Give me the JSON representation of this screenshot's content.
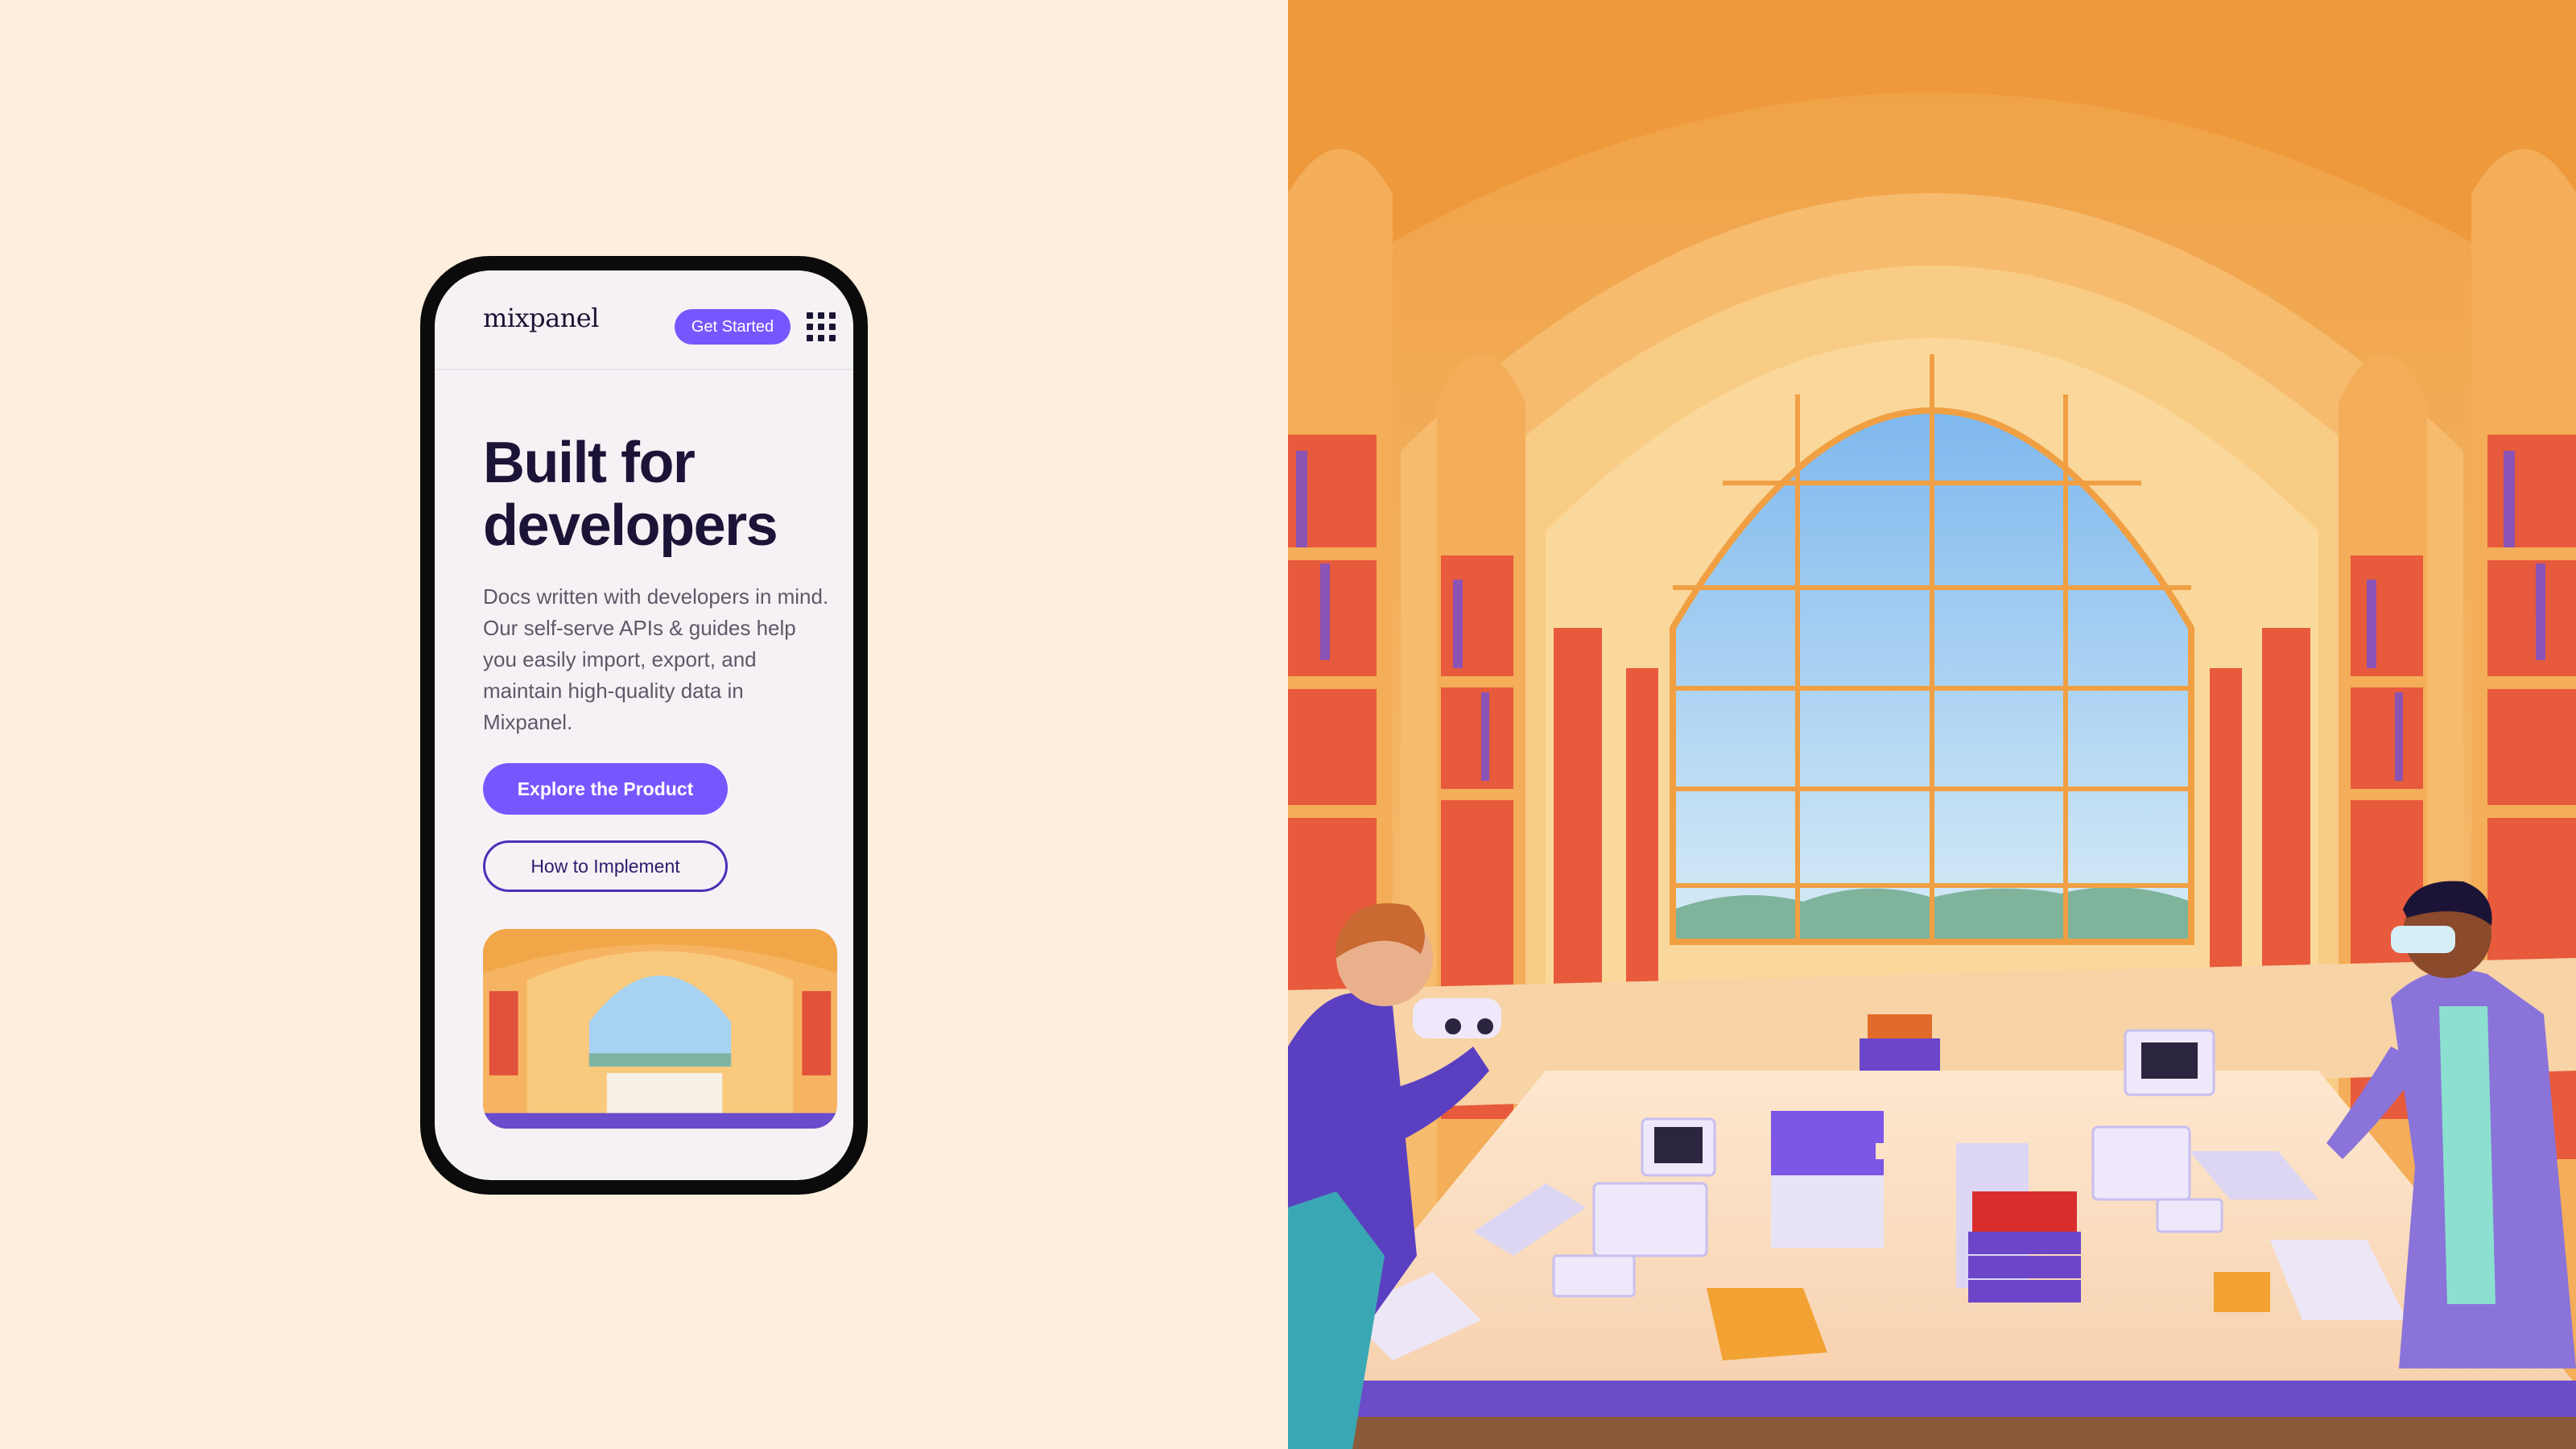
{
  "brand": {
    "logo": "mixpanel"
  },
  "nav": {
    "cta_label": "Get Started",
    "menu_icon": "grid-menu-icon"
  },
  "hero": {
    "headline_line1": "Built for",
    "headline_line2": "developers",
    "description": "Docs written with developers in mind. Our self-serve APIs & guides help you easily import, export, and maintain high-quality data in Mixpanel.",
    "primary_button": "Explore the Product",
    "secondary_button": "How to Implement"
  },
  "colors": {
    "page_background": "#fdeedd",
    "accent": "#7856ff",
    "outline_button": "#4b2fb8",
    "headline": "#1c1437",
    "body_text": "#5f5868"
  }
}
